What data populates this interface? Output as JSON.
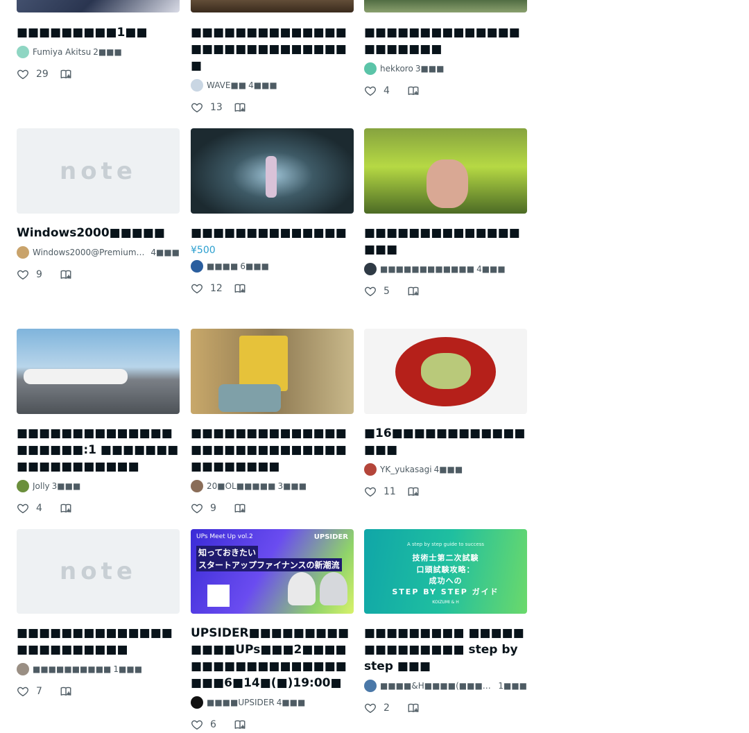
{
  "colors": {
    "accent": "#2b9fcf",
    "text": "#08131a",
    "muted": "#4e5b63"
  },
  "row1": [
    {
      "title": "■■■■■■■■■1■■",
      "author": "Fumiya Akitsu",
      "ago": "2■■■",
      "likes": "29"
    },
    {
      "title": "■■■■■■■■■■■■■■■■■■■■■■■■■■■■■",
      "author": "WAVE■■",
      "ago": "4■■■",
      "likes": "13"
    },
    {
      "title": "■■■■■■■■■■■■■■■■■■■■■",
      "author": "hekkoro",
      "ago": "3■■■",
      "likes": "4"
    }
  ],
  "row2": [
    {
      "title": "Windows2000■■■■■",
      "author": "Windows2000@Premium_E…",
      "ago": "4■■■",
      "likes": "9",
      "note_logo": "note"
    },
    {
      "title": "■■■■■■■■■■■■■■",
      "price": "¥500",
      "author": "■■■■",
      "ago": "6■■■",
      "likes": "12"
    },
    {
      "title": "■■■■■■■■■■■■■■■■■",
      "author": "■■■■■■■■■■■■",
      "ago": "4■■■",
      "likes": "5"
    }
  ],
  "row3": [
    {
      "title": "■■■■■■■■■■■■■■■■■■■■:1 ■■■■■■■■■■■■■■■■■■",
      "author": "Jolly",
      "ago": "3■■■",
      "likes": "4"
    },
    {
      "title": "■■■■■■■■■■■■■■■■■■■■■■■■■■■■■■■■■■■■",
      "author": "20■OL■■■■■",
      "ago": "3■■■",
      "likes": "9"
    },
    {
      "title": "■16■■■■■■■■■■■■■■■",
      "author": "YK_yukasagi",
      "ago": "4■■■",
      "likes": "11"
    }
  ],
  "row4": [
    {
      "title": "■■■■■■■■■■■■■■■■■■■■■■■■",
      "author": "■■■■■■■■■■",
      "ago": "1■■■",
      "likes": "7",
      "note_logo": "note"
    },
    {
      "title": "UPSIDER■■■■■■■■■■■■■UPs■■■2■■■■■■■■■■■■■■■■■■■■■6■14■(■)19:00■",
      "author": "■■■■UPSIDER",
      "ago": "4■■■",
      "likes": "6",
      "banner": {
        "top_left": "UPs Meet Up vol.2",
        "brand": "UPSIDER",
        "line1": "知っておきたい",
        "line2": "スタートアップファイナンスの新潮流"
      }
    },
    {
      "title": "■■■■■■■■■ ■■■■■■■■■■■■■■ step by step ■■■",
      "author": "■■■■&H■■■■(■■■■■■■■■)■■■■■",
      "ago": "1■■■",
      "likes": "2",
      "banner": {
        "small": "A step by step guide to success",
        "l1": "技術士第二次試験",
        "l2": "口頭試験攻略：",
        "l3": "成功への",
        "l4": "STEP BY STEP ガイド",
        "l5": "KOIZUMI & H"
      }
    }
  ]
}
